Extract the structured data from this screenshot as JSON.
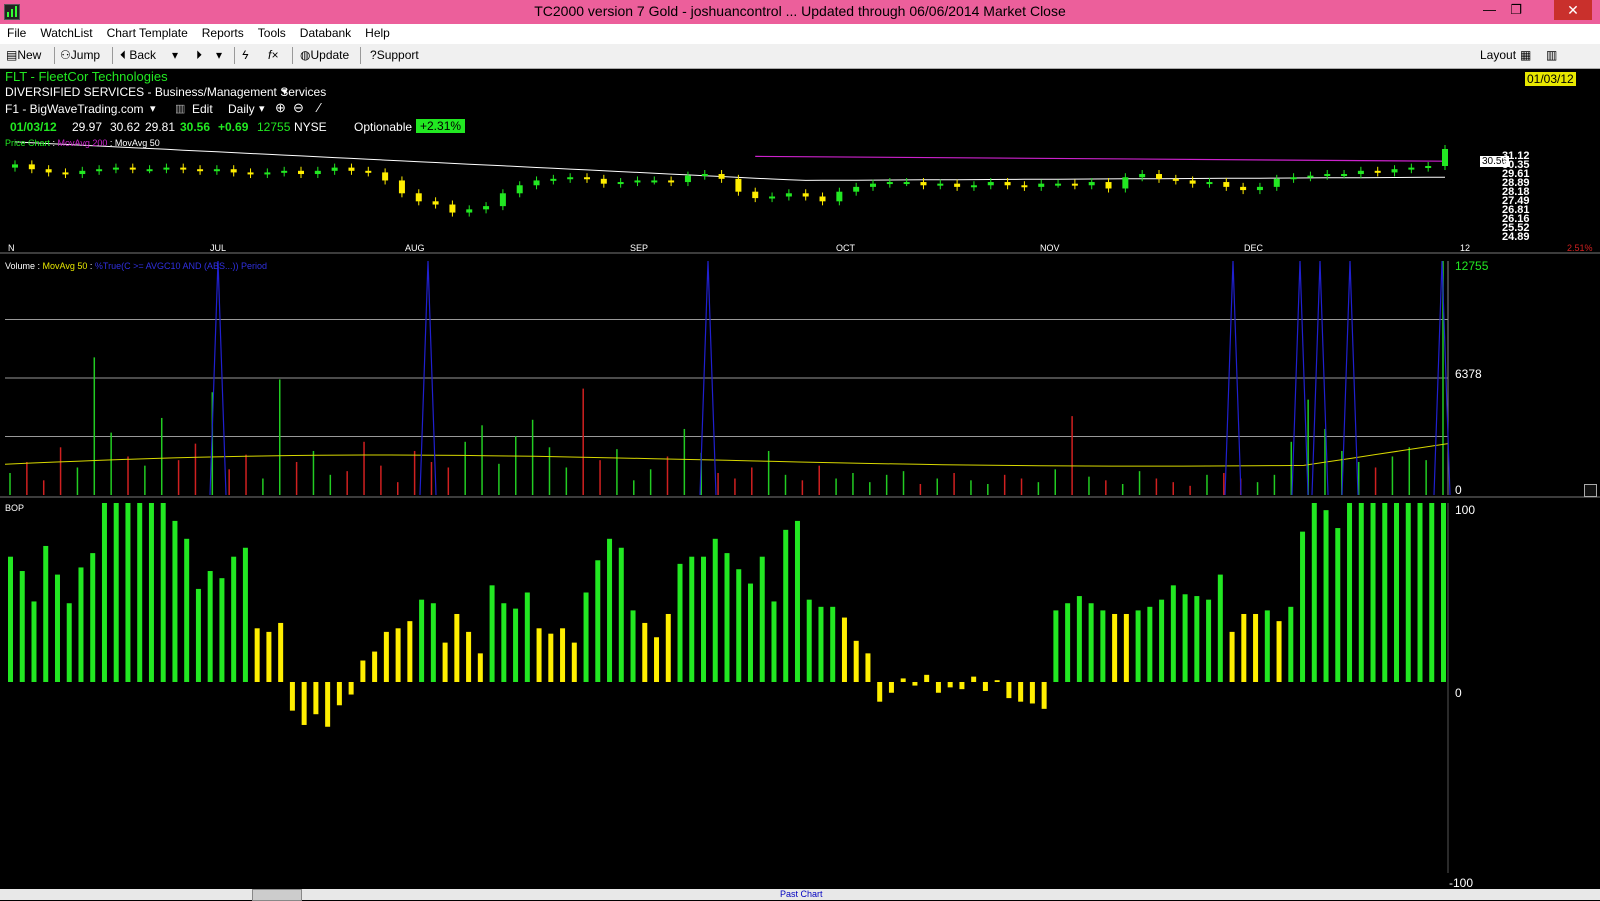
{
  "window": {
    "title": "TC2000 version 7 Gold - joshuancontrol  ... Updated through 06/06/2014  Market Close",
    "minimize": "—",
    "restore": "❐",
    "close": "✕"
  },
  "menu": [
    "File",
    "WatchList",
    "Chart Template",
    "Reports",
    "Tools",
    "Databank",
    "Help"
  ],
  "toolbar": {
    "new_label": "New",
    "jump_label": "Jump",
    "back_label": "Back",
    "update_label": "Update",
    "support_label": "Support",
    "layout_label": "Layout"
  },
  "header": {
    "symbol_title": "FLT - FleetCor Technologies",
    "sector": "DIVERSIFIED SERVICES - Business/Management Services",
    "template": "F1 - BigWaveTrading.com",
    "edit_label": "Edit",
    "timeframe": "Daily",
    "date": "01/03/12",
    "open": "29.97",
    "high": "30.62",
    "low": "29.81",
    "close": "30.56",
    "change": "+0.69",
    "volume": "12755",
    "exchange": "NYSE",
    "optionable": "Optionable",
    "pct_change": "+2.31%",
    "date_badge": "01/03/12"
  },
  "price_pane": {
    "legend_price": "Price Chart",
    "legend_ma200": "MovAvg 200",
    "legend_ma50": "MovAvg 50",
    "last_price": "30.56",
    "scale": [
      "31.12",
      "30.35",
      "29.61",
      "28.89",
      "28.18",
      "27.49",
      "26.81",
      "26.16",
      "25.52",
      "24.89"
    ],
    "pct_label": "2.51%",
    "months": [
      "N",
      "JUL",
      "AUG",
      "SEP",
      "OCT",
      "NOV",
      "DEC",
      "12"
    ]
  },
  "volume_pane": {
    "legend_volume": "Volume",
    "legend_ma": "MovAvg 50",
    "legend_custom": "%True(C >= AVGC10 AND (ABS...)) Period",
    "scale": [
      "12755",
      "6378",
      "0"
    ]
  },
  "bop_pane": {
    "legend": "BOP",
    "scale": [
      "100",
      "0",
      "-100"
    ]
  },
  "bottom": {
    "past_chart": "Past Chart"
  },
  "colors": {
    "up": "#22e822",
    "down": "#ffee00",
    "volume_up": "#22cc22",
    "volume_down": "#d02020",
    "ma200": "#cc22cc",
    "ma50": "#ffffff",
    "volume_ma": "#d8d800",
    "custom_indicator": "#2020d0",
    "title_bar": "#ec5f9b"
  },
  "chart_data": [
    {
      "type": "candlestick",
      "name": "Price Chart",
      "ylim": [
        24.89,
        31.12
      ],
      "x_months": [
        "JUL",
        "AUG",
        "SEP",
        "OCT",
        "NOV",
        "DEC"
      ],
      "closes": [
        29.6,
        29.3,
        29.1,
        29.0,
        29.2,
        29.3,
        29.4,
        29.3,
        29.3,
        29.4,
        29.3,
        29.2,
        29.3,
        29.1,
        29.0,
        29.1,
        29.2,
        29.0,
        29.2,
        29.4,
        29.2,
        29.1,
        28.6,
        27.8,
        27.3,
        27.1,
        26.6,
        26.8,
        27.0,
        27.8,
        28.3,
        28.6,
        28.7,
        28.8,
        28.7,
        28.4,
        28.5,
        28.6,
        28.6,
        28.5,
        28.9,
        29.0,
        28.7,
        27.9,
        27.5,
        27.6,
        27.8,
        27.6,
        27.3,
        27.9,
        28.2,
        28.4,
        28.5,
        28.5,
        28.3,
        28.4,
        28.2,
        28.3,
        28.5,
        28.3,
        28.2,
        28.4,
        28.4,
        28.3,
        28.5,
        28.1,
        28.8,
        29.0,
        28.7,
        28.6,
        28.4,
        28.5,
        28.2,
        28.0,
        28.2,
        28.7,
        28.8,
        28.9,
        29.0,
        29.0,
        29.2,
        29.1,
        29.3,
        29.4,
        29.5,
        30.56
      ],
      "ma200": {
        "start_index": 44,
        "values_start": 30.1,
        "values_end": 29.8
      },
      "ma50": {
        "values_start": 31.0,
        "values_mid": 28.6,
        "values_end": 28.8
      }
    },
    {
      "type": "bar",
      "name": "Volume",
      "ylim": [
        0,
        12755
      ],
      "values": [
        1200,
        1800,
        800,
        2600,
        1500,
        7500,
        3400,
        2100,
        1600,
        4200,
        1900,
        2800,
        5600,
        1400,
        2200,
        900,
        6300,
        1800,
        2400,
        1100,
        1300,
        2900,
        1600,
        700,
        2400,
        1800,
        1500,
        2900,
        3800,
        1700,
        3200,
        4100,
        2600,
        1500,
        5800,
        1900,
        2500,
        800,
        1400,
        2100,
        3600,
        2300,
        1200,
        900,
        1500,
        2400,
        1100,
        800,
        1600,
        900,
        1200,
        700,
        1100,
        1300,
        600,
        900,
        1200,
        800,
        600,
        1100,
        900,
        700,
        1400,
        4300,
        1000,
        800,
        600,
        1300,
        900,
        700,
        500,
        1100,
        1200,
        900,
        700,
        1100,
        2900,
        5200,
        3600,
        2400,
        1800,
        1500,
        2100,
        2600,
        1900,
        12755
      ],
      "ma50_level_approx": 1400,
      "custom_indicator_spikes_x_months": [
        "JUL",
        "AUG",
        "SEP",
        "DEC",
        "DEC",
        "DEC",
        "DEC"
      ]
    },
    {
      "type": "bar",
      "name": "BOP",
      "ylim": [
        -100,
        100
      ],
      "values": [
        70,
        62,
        45,
        76,
        60,
        44,
        64,
        72,
        100,
        100,
        100,
        100,
        100,
        100,
        90,
        80,
        52,
        62,
        58,
        70,
        75,
        30,
        28,
        33,
        -16,
        -24,
        -18,
        -25,
        -13,
        -7,
        12,
        17,
        28,
        30,
        34,
        46,
        44,
        22,
        38,
        28,
        16,
        54,
        44,
        41,
        50,
        30,
        27,
        30,
        22,
        50,
        68,
        80,
        75,
        40,
        33,
        25,
        38,
        66,
        70,
        70,
        80,
        72,
        63,
        55,
        70,
        45,
        85,
        90,
        46,
        42,
        42,
        36,
        23,
        16,
        -11,
        -6,
        2,
        -2,
        4,
        -6,
        -3,
        -4,
        3,
        -5,
        1,
        -9,
        -11,
        -12,
        -15,
        40,
        44,
        48,
        44,
        40,
        38,
        38,
        40,
        42,
        46,
        54,
        49,
        48,
        46,
        60,
        28,
        38,
        38,
        40,
        34,
        42,
        84,
        100,
        96,
        86,
        100,
        100,
        100,
        100,
        100,
        100,
        100,
        100,
        100
      ]
    }
  ]
}
